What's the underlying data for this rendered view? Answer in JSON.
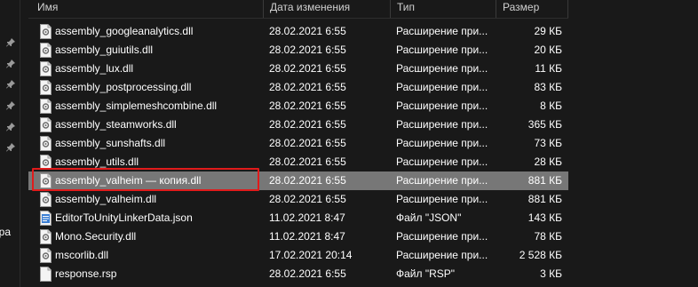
{
  "nav": {
    "cut_label": "epa",
    "pins": [
      "pin-icon",
      "pin-icon",
      "pin-icon",
      "pin-icon",
      "pin-icon",
      "pin-icon"
    ]
  },
  "columns": {
    "name": "Имя",
    "date": "Дата изменения",
    "type": "Тип",
    "size": "Размер"
  },
  "files": [
    {
      "name": "assembly_googleanalytics.dll",
      "date": "28.02.2021 6:55",
      "type": "Расширение при...",
      "size": "29 КБ",
      "icon": "dll-file-icon"
    },
    {
      "name": "assembly_guiutils.dll",
      "date": "28.02.2021 6:55",
      "type": "Расширение при...",
      "size": "20 КБ",
      "icon": "dll-file-icon"
    },
    {
      "name": "assembly_lux.dll",
      "date": "28.02.2021 6:55",
      "type": "Расширение при...",
      "size": "11 КБ",
      "icon": "dll-file-icon"
    },
    {
      "name": "assembly_postprocessing.dll",
      "date": "28.02.2021 6:55",
      "type": "Расширение при...",
      "size": "83 КБ",
      "icon": "dll-file-icon"
    },
    {
      "name": "assembly_simplemeshcombine.dll",
      "date": "28.02.2021 6:55",
      "type": "Расширение при...",
      "size": "8 КБ",
      "icon": "dll-file-icon"
    },
    {
      "name": "assembly_steamworks.dll",
      "date": "28.02.2021 6:55",
      "type": "Расширение при...",
      "size": "365 КБ",
      "icon": "dll-file-icon"
    },
    {
      "name": "assembly_sunshafts.dll",
      "date": "28.02.2021 6:55",
      "type": "Расширение при...",
      "size": "73 КБ",
      "icon": "dll-file-icon"
    },
    {
      "name": "assembly_utils.dll",
      "date": "28.02.2021 6:55",
      "type": "Расширение при...",
      "size": "28 КБ",
      "icon": "dll-file-icon"
    },
    {
      "name": "assembly_valheim — копия.dll",
      "date": "28.02.2021 6:55",
      "type": "Расширение при...",
      "size": "881 КБ",
      "icon": "dll-file-icon",
      "selected": true
    },
    {
      "name": "assembly_valheim.dll",
      "date": "28.02.2021 6:55",
      "type": "Расширение при...",
      "size": "881 КБ",
      "icon": "dll-file-icon"
    },
    {
      "name": "EditorToUnityLinkerData.json",
      "date": "11.02.2021 8:47",
      "type": "Файл \"JSON\"",
      "size": "143 КБ",
      "icon": "json-file-icon"
    },
    {
      "name": "Mono.Security.dll",
      "date": "11.02.2021 8:47",
      "type": "Расширение при...",
      "size": "78 КБ",
      "icon": "dll-file-icon"
    },
    {
      "name": "mscorlib.dll",
      "date": "17.02.2021 20:14",
      "type": "Расширение при...",
      "size": "2 528 КБ",
      "icon": "dll-file-icon"
    },
    {
      "name": "response.rsp",
      "date": "28.02.2021 6:55",
      "type": "Файл \"RSP\"",
      "size": "3 КБ",
      "icon": "generic-file-icon"
    }
  ],
  "colors": {
    "background": "#191919",
    "selected_row": "#777777",
    "annotation_box": "#e01b1b"
  }
}
